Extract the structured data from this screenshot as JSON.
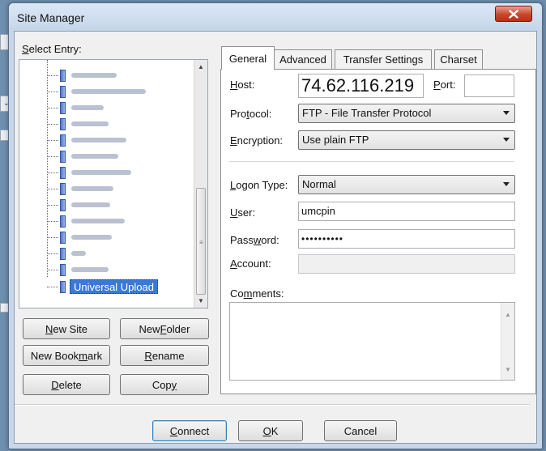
{
  "window": {
    "title": "Site Manager"
  },
  "select_entry": {
    "label_u": "S",
    "label_rest": "elect Entry:"
  },
  "tree": {
    "items": [
      {
        "label": "",
        "blur_w": 56
      },
      {
        "label": "",
        "blur_w": 92
      },
      {
        "label": "",
        "blur_w": 40
      },
      {
        "label": "",
        "blur_w": 46
      },
      {
        "label": "",
        "blur_w": 68
      },
      {
        "label": "",
        "blur_w": 58
      },
      {
        "label": "",
        "blur_w": 74
      },
      {
        "label": "",
        "blur_w": 52
      },
      {
        "label": "",
        "blur_w": 48
      },
      {
        "label": "",
        "blur_w": 66
      },
      {
        "label": "",
        "blur_w": 50
      },
      {
        "label": "",
        "blur_w": 18
      },
      {
        "label": "",
        "blur_w": 46
      }
    ],
    "selected": "Universal Upload"
  },
  "buttons": {
    "new_site": {
      "u": "N",
      "rest": "ew Site"
    },
    "new_folder": {
      "pre": "New ",
      "u": "F",
      "rest": "older"
    },
    "new_bookmark": {
      "pre": "New Book",
      "u": "m",
      "rest": "ark"
    },
    "rename": {
      "u": "R",
      "rest": "ename"
    },
    "delete": {
      "u": "D",
      "rest": "elete"
    },
    "copy": {
      "pre": "Cop",
      "u": "y",
      "rest": ""
    },
    "connect": {
      "pre": "",
      "u": "C",
      "rest": "onnect"
    },
    "ok": {
      "u": "O",
      "rest": "K"
    },
    "cancel": "Cancel"
  },
  "tabs": [
    "General",
    "Advanced",
    "Transfer Settings",
    "Charset"
  ],
  "general": {
    "host_label": {
      "u": "H",
      "rest": "ost:"
    },
    "host_value": "74.62.116.219",
    "port_label": {
      "u": "P",
      "rest": "ort:"
    },
    "port_value": "",
    "protocol_label": {
      "pre": "Pro",
      "u": "t",
      "rest": "ocol:"
    },
    "protocol_value": "FTP - File Transfer Protocol",
    "encryption_label": {
      "u": "E",
      "rest": "ncryption:"
    },
    "encryption_value": "Use plain FTP",
    "logon_label": {
      "u": "L",
      "rest": "ogon Type:"
    },
    "logon_value": "Normal",
    "user_label": {
      "u": "U",
      "rest": "ser:"
    },
    "user_value": "umcpin",
    "password_label": {
      "pre": "Pass",
      "u": "w",
      "rest": "ord:"
    },
    "password_value": "••••••••••",
    "account_label": {
      "u": "A",
      "rest": "ccount:"
    },
    "account_value": "",
    "comments_label": {
      "pre": "Co",
      "u": "m",
      "rest": "ments:"
    }
  }
}
